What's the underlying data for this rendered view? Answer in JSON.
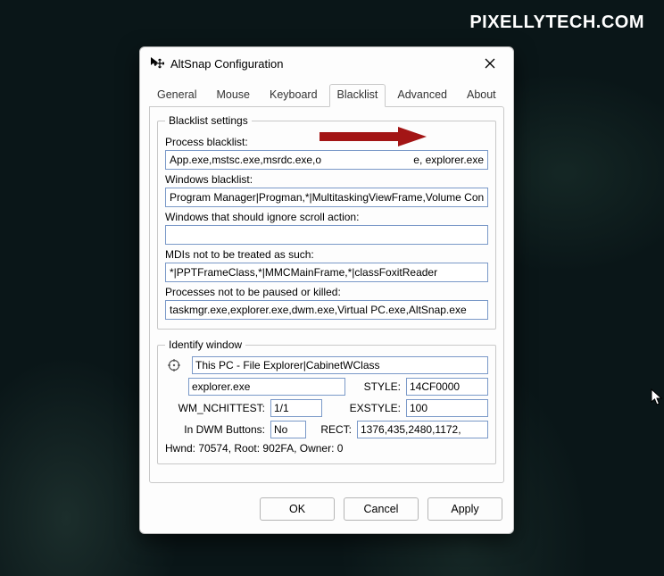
{
  "watermark": "PIXELLYTECH.COM",
  "dialog": {
    "title": "AltSnap Configuration"
  },
  "tabs": {
    "general": "General",
    "mouse": "Mouse",
    "keyboard": "Keyboard",
    "blacklist": "Blacklist",
    "advanced": "Advanced",
    "about": "About"
  },
  "blacklist": {
    "legend": "Blacklist settings",
    "process_label": "Process blacklist:",
    "process_value_left": "App.exe,mstsc.exe,msrdc.exe,o",
    "process_value_right": "e, explorer.exe",
    "windows_label": "Windows blacklist:",
    "windows_value": "Program Manager|Progman,*|MultitaskingViewFrame,Volume Cont",
    "scroll_label": "Windows that should ignore scroll action:",
    "scroll_value": "",
    "mdi_label": "MDIs not to be treated as such:",
    "mdi_value": "*|PPTFrameClass,*|MMCMainFrame,*|classFoxitReader",
    "pause_label": "Processes not to be paused or killed:",
    "pause_value": "taskmgr.exe,explorer.exe,dwm.exe,Virtual PC.exe,AltSnap.exe"
  },
  "identify": {
    "legend": "Identify window",
    "window_value": "This PC - File Explorer|CabinetWClass",
    "exe_value": "explorer.exe",
    "style_label": "STYLE:",
    "style_value": "14CF0000",
    "wm_label": "WM_NCHITTEST:",
    "wm_value": "1/1",
    "exstyle_label": "EXSTYLE:",
    "exstyle_value": "100",
    "dwm_label": "In DWM Buttons:",
    "dwm_value": "No",
    "rect_label": "RECT:",
    "rect_value": "1376,435,2480,1172,",
    "hwnd_line": "Hwnd: 70574, Root: 902FA, Owner: 0"
  },
  "buttons": {
    "ok": "OK",
    "cancel": "Cancel",
    "apply": "Apply"
  }
}
